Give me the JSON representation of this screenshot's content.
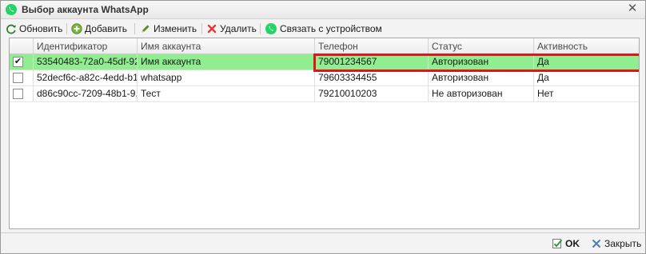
{
  "window": {
    "title": "Выбор аккаунта WhatsApp",
    "close_label": "✕"
  },
  "toolbar": {
    "refresh_label": "Обновить",
    "add_label": "Добавить",
    "edit_label": "Изменить",
    "delete_label": "Удалить",
    "link_label": "Связать с устройством"
  },
  "grid": {
    "columns": [
      "Идентификатор",
      "Имя аккаунта",
      "Телефон",
      "Статус",
      "Активность"
    ],
    "rows": [
      {
        "checked": "✔",
        "id": "53540483-72a0-45df-92...",
        "name": "Имя аккаунта",
        "phone": "79001234567",
        "status": "Авторизован",
        "active": "Да"
      },
      {
        "checked": "",
        "id": "52decf6c-a82c-4edd-b1...",
        "name": "whatsapp",
        "phone": "79603334455",
        "status": "Авторизован",
        "active": "Да"
      },
      {
        "checked": "",
        "id": "d86c90cc-7209-48b1-9...",
        "name": "Тест",
        "phone": "79210010203",
        "status": "Не авторизован",
        "active": "Нет"
      }
    ]
  },
  "footer": {
    "ok_label": "OK",
    "close_label": "Закрыть"
  },
  "colors": {
    "selected_row": "#90ee90",
    "highlight_border": "#e0141a",
    "whatsapp_green": "#25d366"
  }
}
